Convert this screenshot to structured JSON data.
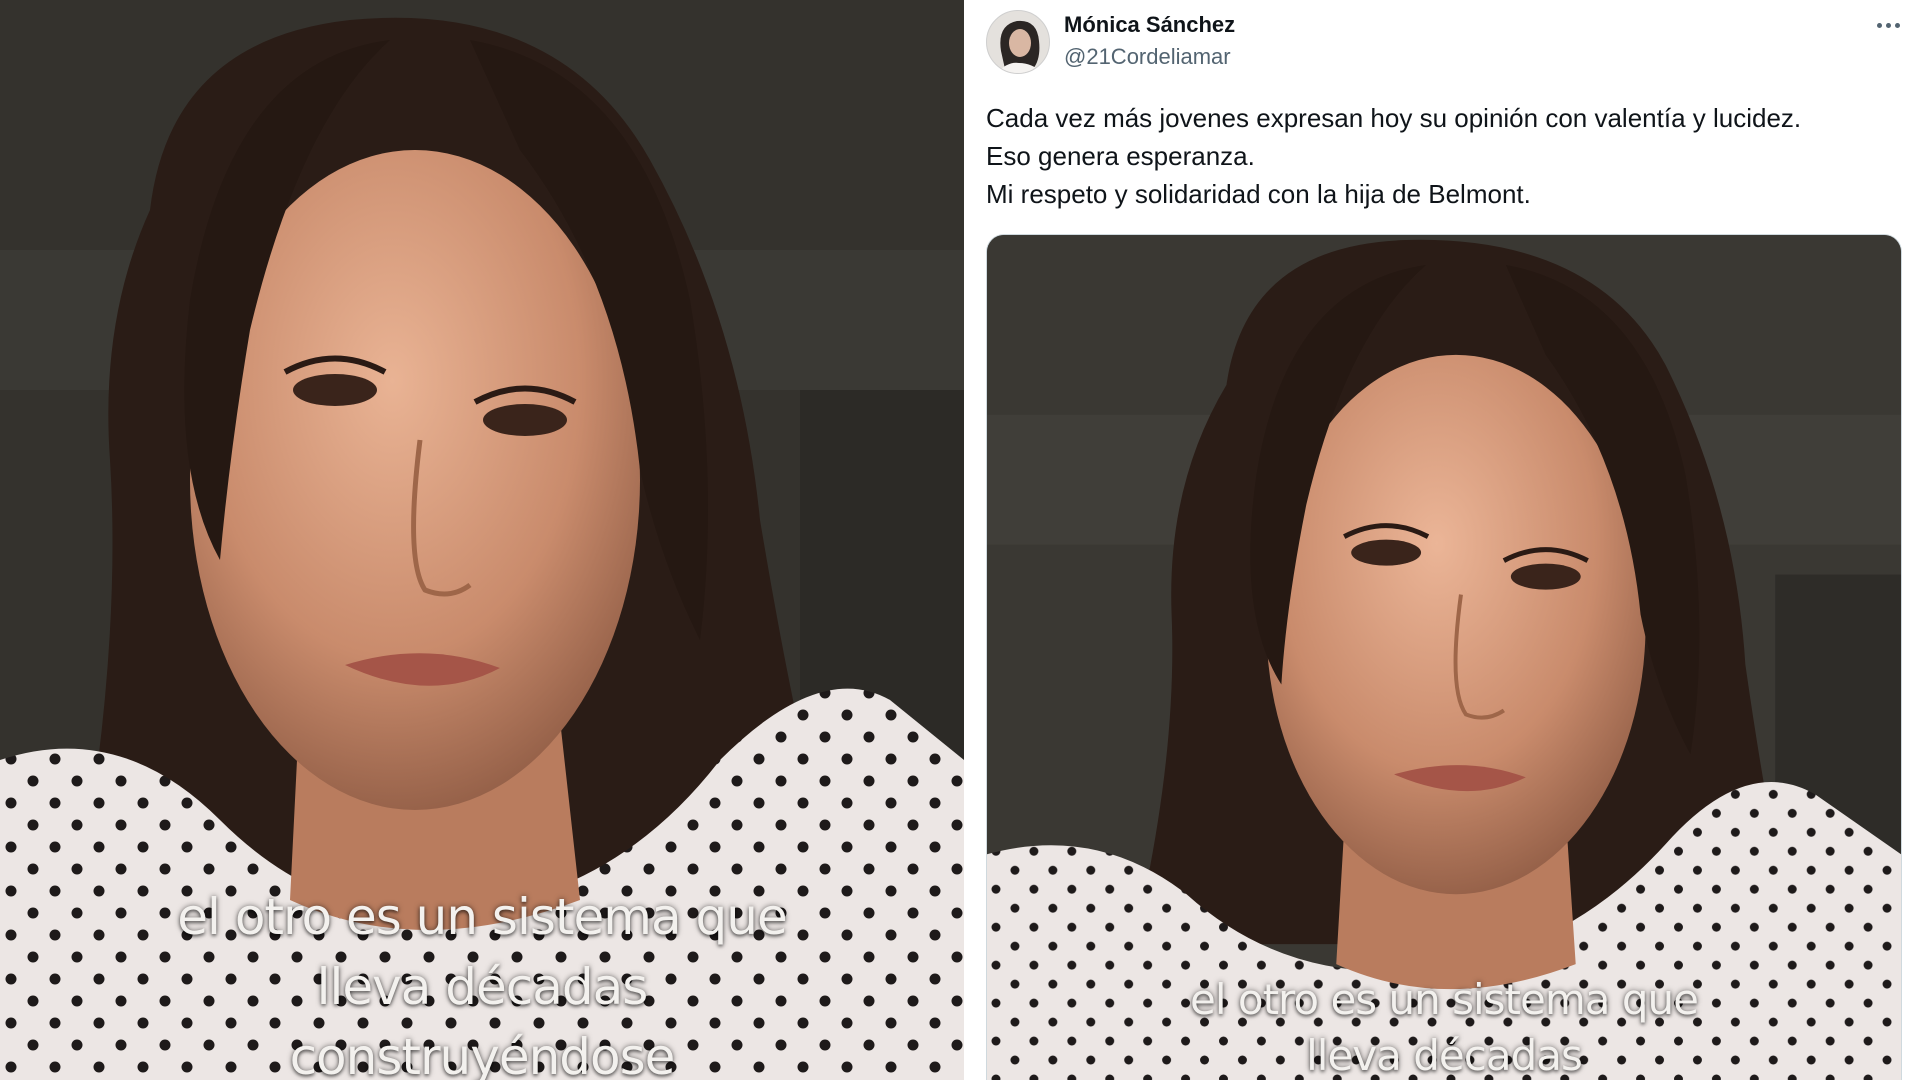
{
  "tweet": {
    "author_name": "Mónica Sánchez",
    "author_handle": "@21Cordeliamar",
    "text_lines": [
      "Cada vez más jovenes expresan hoy su opinión con valentía y lucidez.",
      "Eso genera esperanza.",
      "Mi respeto y solidaridad con la hija de Belmont."
    ]
  },
  "left_video": {
    "captions": [
      "el otro es un sistema que",
      "lleva décadas",
      "construyéndose"
    ]
  },
  "tweet_video": {
    "captions": [
      "el otro es un sistema que",
      "lleva décadas"
    ]
  },
  "icons": {
    "more": "more-horizontal-icon",
    "avatar": "profile-avatar"
  },
  "colors": {
    "text_primary": "#0f1419",
    "text_secondary": "#536471"
  }
}
